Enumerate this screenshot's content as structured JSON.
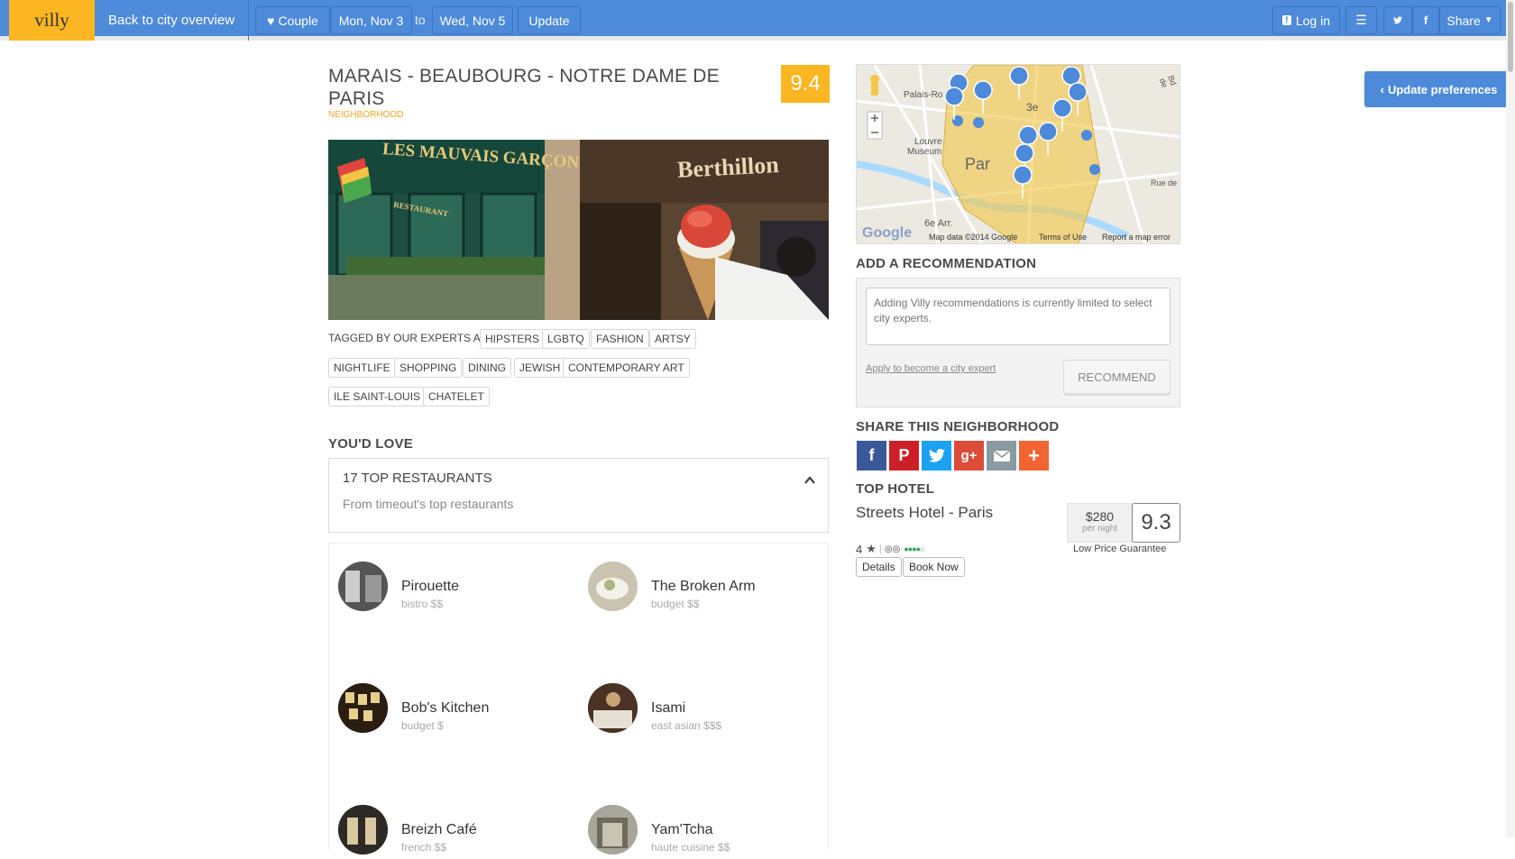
{
  "topbar": {
    "logo": "villy",
    "back": "Back to city overview",
    "couple": "Couple",
    "date_from": "Mon, Nov 3",
    "to_label": "to",
    "date_to": "Wed, Nov 5",
    "update": "Update",
    "login": "Log in",
    "share": "Share"
  },
  "neighborhood": {
    "title": "MARAIS - BEAUBOURG - NOTRE DAME DE PARIS",
    "type": "NEIGHBORHOOD",
    "score": "9.4",
    "photo1_text": "LES MAUVAIS GARÇONS",
    "photo1_sign": "RESTAURANT",
    "photo2_text": "Berthillon"
  },
  "tags": {
    "intro": "TAGGED BY OUR EXPERTS AS:",
    "items": [
      "HIPSTERS",
      "LGBTQ",
      "FASHION",
      "ARTSY",
      "NIGHTLIFE",
      "SHOPPING",
      "DINING",
      "JEWISH",
      "CONTEMPORARY ART",
      "ILE SAINT-LOUIS",
      "CHATELET"
    ]
  },
  "love": {
    "heading": "YOU'D LOVE",
    "title": "17 TOP RESTAURANTS",
    "subtitle": "From timeout's top restaurants"
  },
  "restaurants": [
    {
      "name": "Pirouette",
      "meta": "bistro $$"
    },
    {
      "name": "The Broken Arm",
      "meta": "budget $$"
    },
    {
      "name": "Bob's Kitchen",
      "meta": "budget $"
    },
    {
      "name": "Isami",
      "meta": "east asian $$$"
    },
    {
      "name": "Breizh Café",
      "meta": "french $$"
    },
    {
      "name": "Yam'Tcha",
      "meta": "haute cuisine $$"
    }
  ],
  "map": {
    "labels": [
      "Palais-Ro",
      "Louvre",
      "Museum",
      "3e",
      "Par",
      "6e Arr.",
      "Rue de",
      "Bd de"
    ],
    "credit": "Map data ©2014 Google",
    "terms": "Terms of Use",
    "report": "Report a map error",
    "google": "Google"
  },
  "recommend": {
    "heading": "ADD A RECOMMENDATION",
    "placeholder": "Adding Villy recommendations is currently limited to select city experts.",
    "apply_link": "Apply to become a city expert",
    "button": "RECOMMEND"
  },
  "share": {
    "heading": "SHARE THIS NEIGHBORHOOD",
    "icons": [
      "facebook-icon",
      "pinterest-icon",
      "twitter-icon",
      "google-plus-icon",
      "email-icon",
      "more-icon"
    ],
    "colors": [
      "#3b5998",
      "#cb2027",
      "#1da1f2",
      "#dd4b39",
      "#8a9aa0",
      "#f26533"
    ]
  },
  "hotel": {
    "heading": "TOP HOTEL",
    "name": "Streets Hotel - Paris",
    "stars": "4",
    "details": "Details",
    "book": "Book Now",
    "price": "$280",
    "price_unit": "per night",
    "score": "9.3",
    "guarantee": "Low Price Guarantee"
  },
  "sidebar": {
    "update_pref": "Update preferences"
  },
  "colors": {
    "brand_blue": "#4d8ad9",
    "accent_yellow": "#fbb621"
  }
}
